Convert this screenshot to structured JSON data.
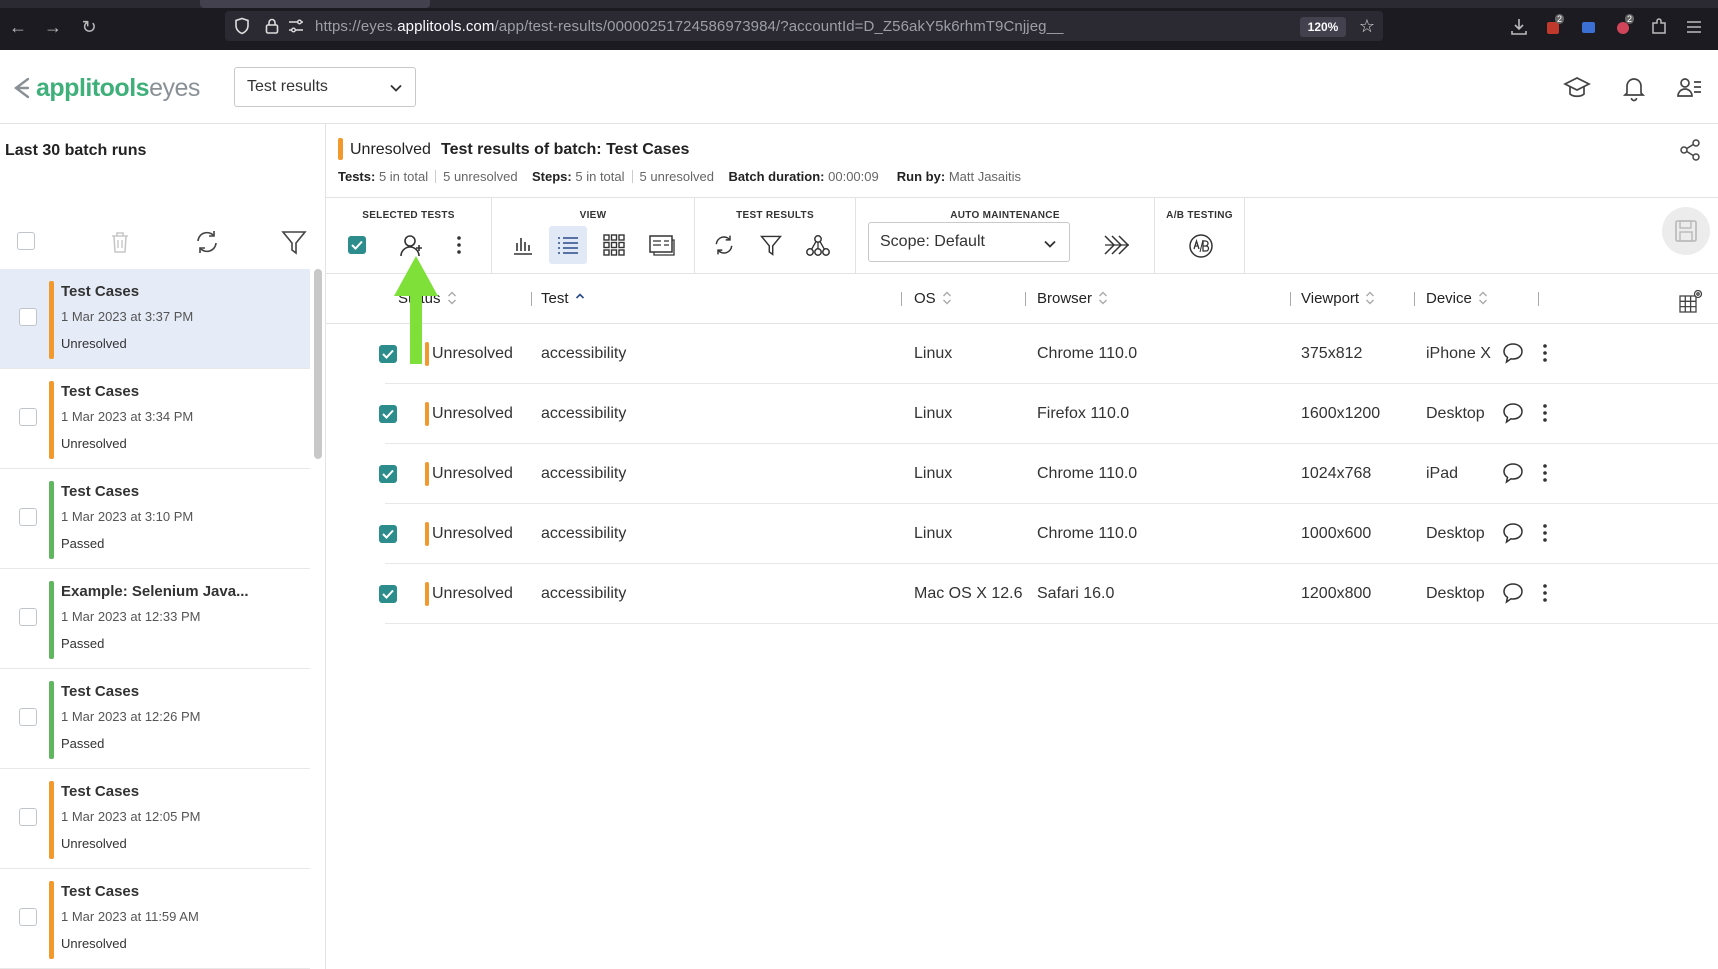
{
  "browser": {
    "url_prefix": "https://eyes.",
    "url_domain": "applitools.com",
    "url_path": "/app/test-results/00000251724586973984/?accountId=D_Z56akY5k6rhmT9Cnjjeg__",
    "zoom": "120%",
    "ext_badge_1": "2",
    "ext_badge_2": "2"
  },
  "header": {
    "logo_strong": "applitools",
    "logo_light": "eyes",
    "page_select": "Test results"
  },
  "sidebar": {
    "title": "Last 30 batch runs",
    "items": [
      {
        "name": "Test Cases",
        "date": "1 Mar 2023 at 3:37 PM",
        "status": "Unresolved",
        "color": "#f2992e",
        "selected": true
      },
      {
        "name": "Test Cases",
        "date": "1 Mar 2023 at 3:34 PM",
        "status": "Unresolved",
        "color": "#f2992e",
        "selected": false
      },
      {
        "name": "Test Cases",
        "date": "1 Mar 2023 at 3:10 PM",
        "status": "Passed",
        "color": "#5fb65f",
        "selected": false
      },
      {
        "name": "Example: Selenium Java...",
        "date": "1 Mar 2023 at 12:33 PM",
        "status": "Passed",
        "color": "#5fb65f",
        "selected": false
      },
      {
        "name": "Test Cases",
        "date": "1 Mar 2023 at 12:26 PM",
        "status": "Passed",
        "color": "#5fb65f",
        "selected": false
      },
      {
        "name": "Test Cases",
        "date": "1 Mar 2023 at 12:05 PM",
        "status": "Unresolved",
        "color": "#f2992e",
        "selected": false
      },
      {
        "name": "Test Cases",
        "date": "1 Mar 2023 at 11:59 AM",
        "status": "Unresolved",
        "color": "#f2992e",
        "selected": false
      }
    ]
  },
  "batch": {
    "status": "Unresolved",
    "title": "Test results of batch:  Test Cases",
    "tests_label": "Tests:",
    "tests_total": "5 in total",
    "tests_unresolved": "5 unresolved",
    "steps_label": "Steps:",
    "steps_total": "5 in total",
    "steps_unresolved": "5 unresolved",
    "duration_label": "Batch duration:",
    "duration": "00:00:09",
    "runby_label": "Run by:",
    "runby": "Matt Jasaitis"
  },
  "toolbar": {
    "selected_tests": "SELECTED TESTS",
    "view": "VIEW",
    "test_results": "TEST RESULTS",
    "auto_maintenance": "AUTO MAINTENANCE",
    "ab_testing": "A/B TESTING",
    "scope": "Scope: Default"
  },
  "table": {
    "columns": [
      "Status",
      "Test",
      "OS",
      "Browser",
      "Viewport",
      "Device"
    ],
    "rows": [
      {
        "status": "Unresolved",
        "test": "accessibility",
        "os": "Linux",
        "browser": "Chrome 110.0",
        "viewport": "375x812",
        "device": "iPhone X"
      },
      {
        "status": "Unresolved",
        "test": "accessibility",
        "os": "Linux",
        "browser": "Firefox 110.0",
        "viewport": "1600x1200",
        "device": "Desktop"
      },
      {
        "status": "Unresolved",
        "test": "accessibility",
        "os": "Linux",
        "browser": "Chrome 110.0",
        "viewport": "1024x768",
        "device": "iPad"
      },
      {
        "status": "Unresolved",
        "test": "accessibility",
        "os": "Linux",
        "browser": "Chrome 110.0",
        "viewport": "1000x600",
        "device": "Desktop"
      },
      {
        "status": "Unresolved",
        "test": "accessibility",
        "os": "Mac OS X 12.6",
        "browser": "Safari 16.0",
        "viewport": "1200x800",
        "device": "Desktop"
      }
    ]
  },
  "colors": {
    "unresolved": "#f2992e",
    "passed": "#5fb65f",
    "brand": "#3fb07a",
    "checkbox": "#2d8c8c",
    "annotation_arrow": "#7fe03a"
  }
}
